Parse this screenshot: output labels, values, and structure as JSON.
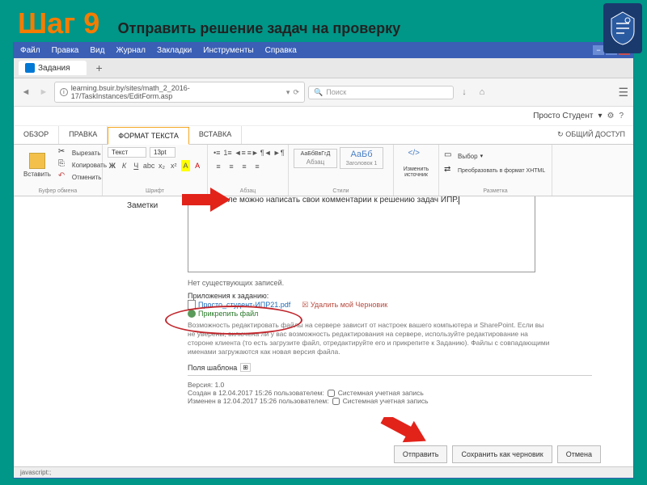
{
  "slide": {
    "step": "Шаг 9",
    "subtitle": "Отправить решение задач на проверку"
  },
  "browser": {
    "menu": [
      "Файл",
      "Правка",
      "Вид",
      "Журнал",
      "Закладки",
      "Инструменты",
      "Справка"
    ],
    "tab_title": "Задания",
    "url": "learning.bsuir.by/sites/math_2_2016-17/TaskInstances/EditForm.asp",
    "search_placeholder": "Поиск",
    "user": "Просто Студент",
    "share": "ОБЩИЙ ДОСТУП"
  },
  "ribbon": {
    "tabs": [
      "ОБЗОР",
      "ПРАВКА",
      "ФОРМАТ ТЕКСТА",
      "ВСТАВКА"
    ],
    "active_tab": 2,
    "clipboard": {
      "paste": "Вставить",
      "cut": "Вырезать",
      "copy": "Копировать",
      "undo": "Отменить",
      "label": "Буфер обмена"
    },
    "font": {
      "face": "Текст",
      "size": "13pt",
      "label": "Шрифт"
    },
    "para": {
      "label": "Абзац"
    },
    "styles": {
      "s1": "АаБбВвГгД",
      "s1l": "Абзац",
      "s2": "АаБб",
      "s2l": "Заголовок 1",
      "label": "Стили"
    },
    "edit": {
      "btn": "Изменить источник",
      "label": ""
    },
    "markup": {
      "sel": "Выбор",
      "conv": "Преобразовать в формат XHTML",
      "label": "Разметка"
    }
  },
  "form": {
    "notes_label": "Заметки",
    "textbox_value": "В этом поле можно написать свои комментарии к решению задач ИПР.",
    "no_records": "Нет существующих записей.",
    "attach_header": "Приложения к заданию:",
    "file_name": "Просто_студент-ИПР21.pdf",
    "delete_draft": "Удалить мой Черновик",
    "attach_file": "Прикрепить файл",
    "info": "Возможность редактировать файлы на сервере зависит от настроек вашего компьютера и SharePoint. Если вы не уверены, включена ли у вас возможность редактирования на сервере, используйте редактирование на стороне клиента (то есть загрузите файл, отредактируйте его и прикрепите к Заданию). Файлы с совпадающими именами загружаются как новая версия файла.",
    "template_fields": "Поля шаблона",
    "version": "Версия: 1.0",
    "created": "Создан в 12.04.2017 15:26 пользователем:",
    "created_sys": "Системная учетная запись",
    "modified": "Изменен в 12.04.2017 15:26 пользователем:",
    "modified_sys": "Системная учетная запись",
    "buttons": {
      "submit": "Отправить",
      "draft": "Сохранить как черновик",
      "cancel": "Отмена"
    },
    "status": "javascript:;"
  }
}
